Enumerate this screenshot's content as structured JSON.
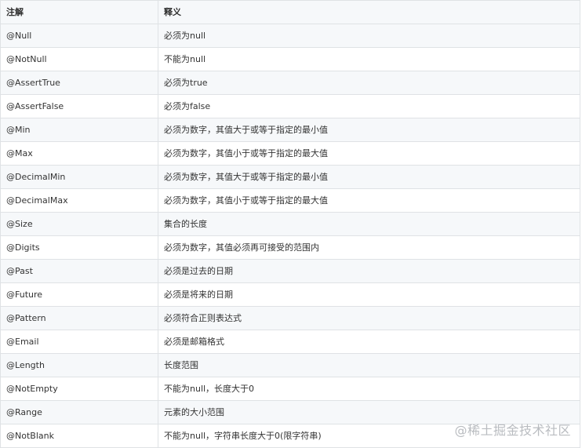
{
  "table": {
    "headers": [
      "注解",
      "释义"
    ],
    "rows": [
      {
        "annotation": "@Null",
        "meaning": "必须为null"
      },
      {
        "annotation": "@NotNull",
        "meaning": "不能为null"
      },
      {
        "annotation": "@AssertTrue",
        "meaning": "必须为true"
      },
      {
        "annotation": "@AssertFalse",
        "meaning": "必须为false"
      },
      {
        "annotation": "@Min",
        "meaning": "必须为数字，其值大于或等于指定的最小值"
      },
      {
        "annotation": "@Max",
        "meaning": "必须为数字，其值小于或等于指定的最大值"
      },
      {
        "annotation": "@DecimalMin",
        "meaning": "必须为数字，其值大于或等于指定的最小值"
      },
      {
        "annotation": "@DecimalMax",
        "meaning": "必须为数字，其值小于或等于指定的最大值"
      },
      {
        "annotation": "@Size",
        "meaning": "集合的长度"
      },
      {
        "annotation": "@Digits",
        "meaning": "必须为数字，其值必须再可接受的范围内"
      },
      {
        "annotation": "@Past",
        "meaning": "必须是过去的日期"
      },
      {
        "annotation": "@Future",
        "meaning": "必须是将来的日期"
      },
      {
        "annotation": "@Pattern",
        "meaning": "必须符合正则表达式"
      },
      {
        "annotation": "@Email",
        "meaning": "必须是邮箱格式"
      },
      {
        "annotation": "@Length",
        "meaning": "长度范围"
      },
      {
        "annotation": "@NotEmpty",
        "meaning": "不能为null，长度大于0"
      },
      {
        "annotation": "@Range",
        "meaning": "元素的大小范围"
      },
      {
        "annotation": "@NotBlank",
        "meaning": "不能为null，字符串长度大于0(限字符串)"
      }
    ]
  },
  "watermark": "@稀土掘金技术社区"
}
